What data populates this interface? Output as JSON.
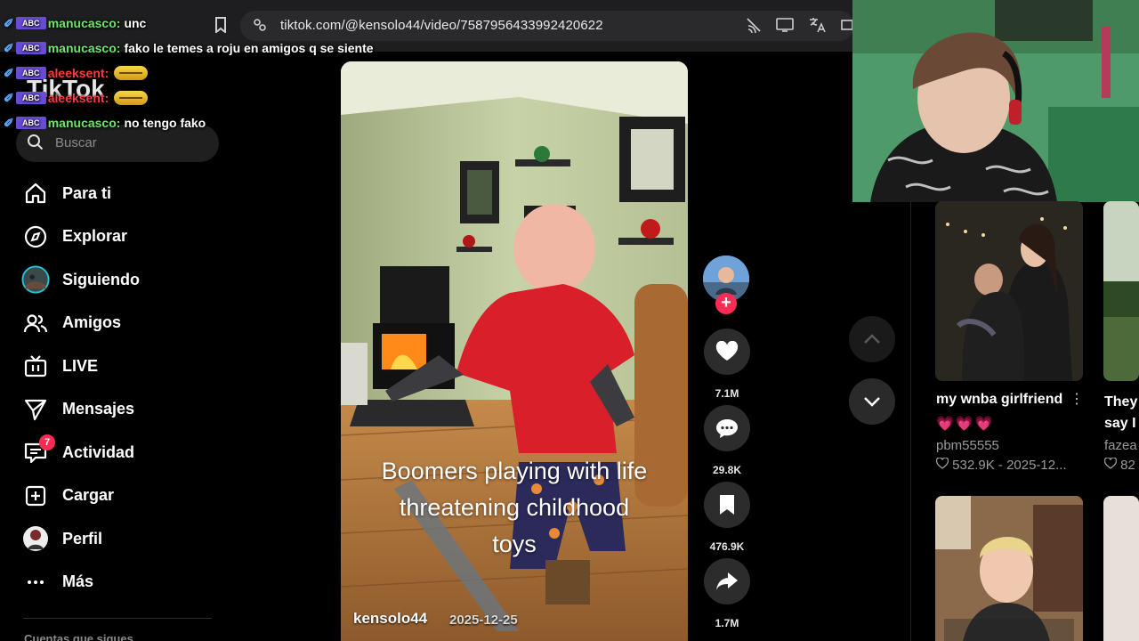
{
  "browser": {
    "url": "tiktok.com/@kensolo44/video/7587956433992420622",
    "icons": [
      "bookmark-icon",
      "site-settings-icon",
      "no-cast-icon",
      "install-app-icon",
      "translate-icon"
    ]
  },
  "chat": [
    {
      "user": "manucasco",
      "text": "unc",
      "color": "#6fe36f"
    },
    {
      "user": "manucasco",
      "text": "fako le temes a roju en amigos q se siente",
      "color": "#6fe36f"
    },
    {
      "user": "aleeksent",
      "text": "",
      "color": "#ff3b3b",
      "emote": "grimace-emote"
    },
    {
      "user": "aleeksent",
      "text": "",
      "color": "#ff3b3b",
      "emote": "grimace-emote"
    },
    {
      "user": "manucasco",
      "text": "no tengo fako",
      "color": "#6fe36f"
    }
  ],
  "sidebar": {
    "logo": "TikTok",
    "search_placeholder": "Buscar",
    "items": [
      {
        "label": "Para ti",
        "icon": "home-icon"
      },
      {
        "label": "Explorar",
        "icon": "compass-icon"
      },
      {
        "label": "Siguiendo",
        "icon": "following-avatar"
      },
      {
        "label": "Amigos",
        "icon": "friends-icon"
      },
      {
        "label": "LIVE",
        "icon": "live-icon"
      },
      {
        "label": "Mensajes",
        "icon": "messages-icon"
      },
      {
        "label": "Actividad",
        "icon": "activity-icon",
        "badge": "7"
      },
      {
        "label": "Cargar",
        "icon": "upload-icon"
      },
      {
        "label": "Perfil",
        "icon": "profile-avatar"
      },
      {
        "label": "Más",
        "icon": "more-icon"
      }
    ],
    "following_header": "Cuentas que sigues"
  },
  "video": {
    "caption_lines": [
      "Boomers playing with life",
      "threatening childhood",
      "toys"
    ],
    "author": "kensolo44",
    "date": "2025-12-25"
  },
  "actions": {
    "likes": "7.1M",
    "comments": "29.8K",
    "saves": "476.9K",
    "shares": "1.7M"
  },
  "recommended": [
    {
      "title": "my wnba girlfriend",
      "hearts": "💗💗💗",
      "user": "pbm55555",
      "likes": "532.9K",
      "date": "2025-12..."
    },
    {
      "title_lines": [
        "They",
        "say I"
      ],
      "user": "fazea",
      "likes": "82"
    }
  ],
  "colors": {
    "accent": "#fe2c55",
    "background": "#000000"
  }
}
